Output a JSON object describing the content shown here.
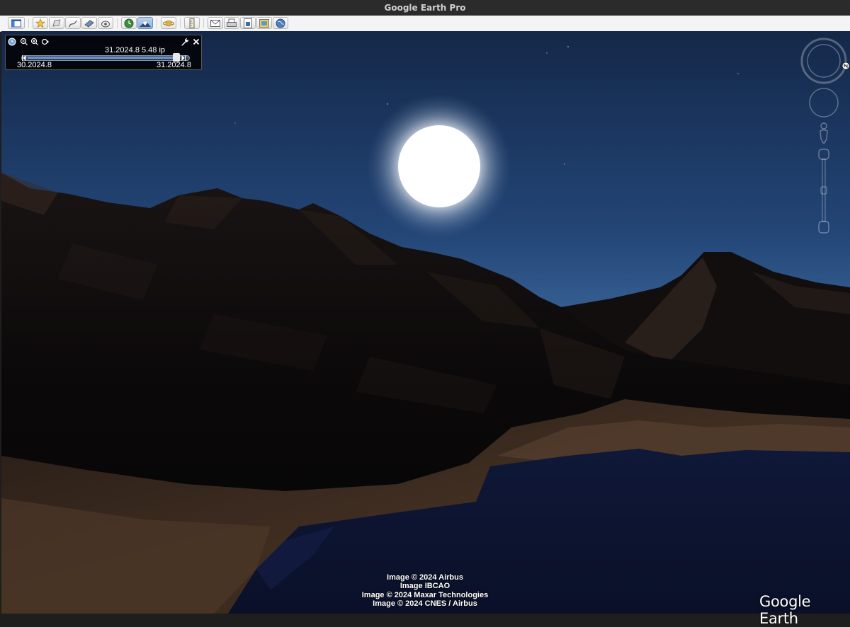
{
  "window": {
    "title": "Google Earth Pro"
  },
  "toolbar": {
    "buttons": [
      {
        "name": "sidebar-toggle",
        "icon": "sidebar-icon",
        "selected": false
      },
      {
        "name": "add-placemark",
        "icon": "placemark-icon",
        "selected": false
      },
      {
        "name": "add-polygon",
        "icon": "polygon-icon",
        "selected": false
      },
      {
        "name": "add-path",
        "icon": "path-icon",
        "selected": false
      },
      {
        "name": "add-image-overlay",
        "icon": "image-overlay-icon",
        "selected": false
      },
      {
        "name": "record-tour",
        "icon": "record-tour-icon",
        "selected": false
      },
      {
        "name": "historical-imagery",
        "icon": "historical-imagery-icon",
        "selected": false
      },
      {
        "name": "sunlight",
        "icon": "sunlight-icon",
        "selected": true
      },
      {
        "name": "switch-planet",
        "icon": "planet-icon",
        "selected": false
      },
      {
        "name": "ruler",
        "icon": "ruler-icon",
        "selected": false
      },
      {
        "name": "email",
        "icon": "email-icon",
        "selected": false
      },
      {
        "name": "print",
        "icon": "print-icon",
        "selected": false
      },
      {
        "name": "save-image",
        "icon": "save-image-icon",
        "selected": false
      },
      {
        "name": "view-in-maps",
        "icon": "maps-icon",
        "selected": false
      },
      {
        "name": "earth-gallery",
        "icon": "globe-icon",
        "selected": false
      }
    ]
  },
  "time_slider": {
    "current_label": "31.2024.8  5.48 ip",
    "start_label": "30.2024.8",
    "end_label": "31.2024.8",
    "position": 0.9
  },
  "credits": [
    "Image © 2024 Airbus",
    "Image IBCAO",
    "Image © 2024 Maxar Technologies",
    "Image © 2024 CNES / Airbus"
  ],
  "logo": {
    "text": "Google Earth"
  },
  "colors": {
    "sky_top": "#142849",
    "sky_horizon": "#5a85b3",
    "sun": "#ffffff",
    "water": "#0d1530",
    "toolbar_selected": "#8fb1df"
  }
}
